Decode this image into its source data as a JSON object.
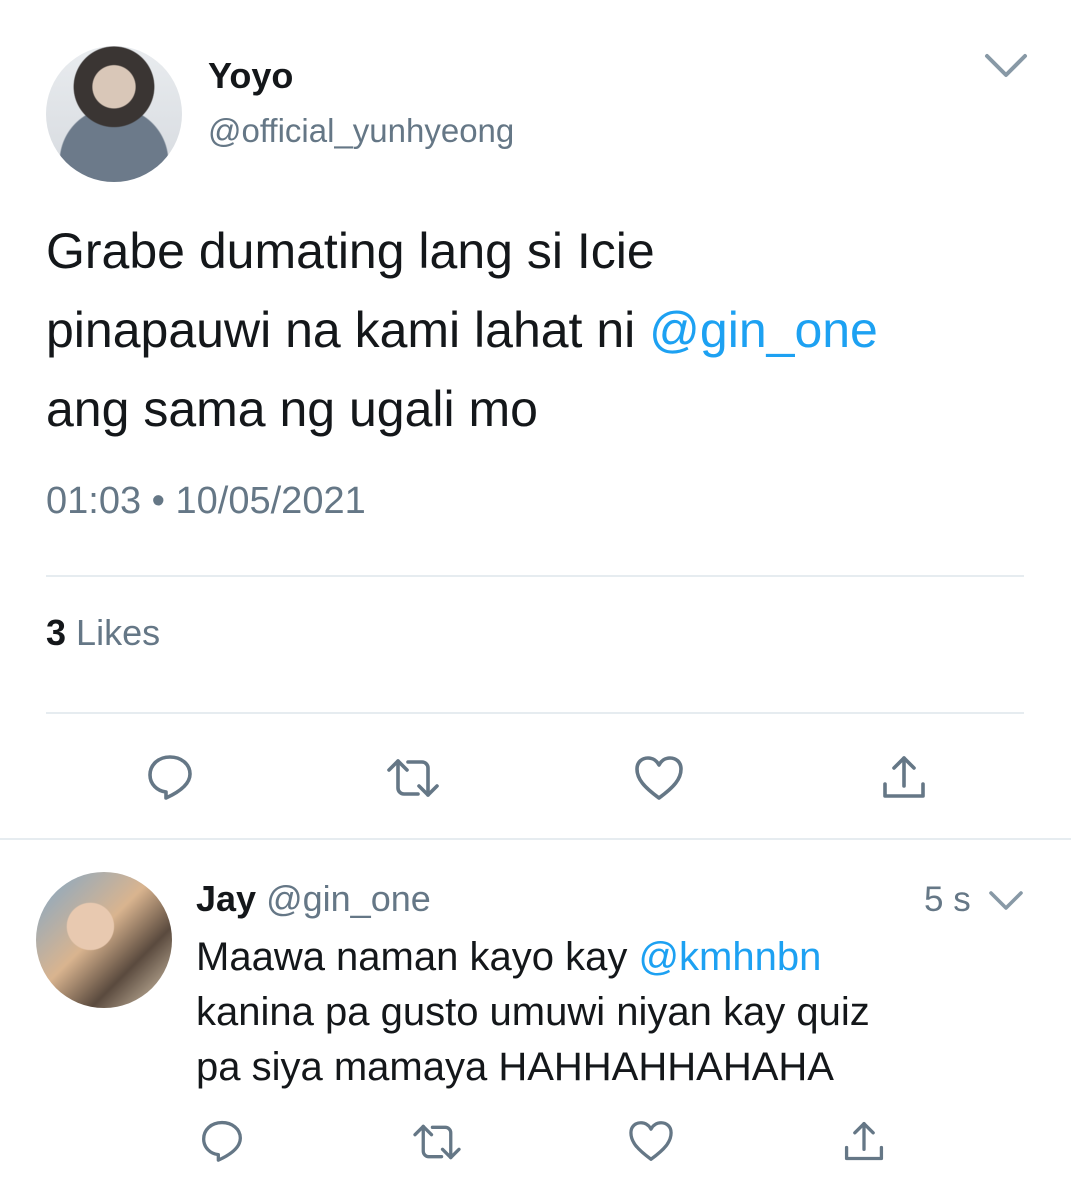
{
  "tweet": {
    "author_name": "Yoyo",
    "author_handle": "@official_yunhyeong",
    "text_line1": "Grabe dumating lang si Icie",
    "text_line2_pre": "pinapauwi na kami lahat ni ",
    "text_line2_mention": "@gin_one",
    "text_line3": "ang sama ng ugali mo",
    "time": "01:03",
    "separator": "•",
    "date": "10/05/2021",
    "likes_count": "3",
    "likes_label": "Likes"
  },
  "reply": {
    "author_name": "Jay",
    "author_handle": "@gin_one",
    "time": "5 s",
    "text_line1_pre": "Maawa naman kayo kay ",
    "text_line1_mention": "@kmhnbn",
    "text_line2": "kanina pa gusto umuwi niyan kay quiz",
    "text_line3": "pa siya mamaya HAHHAHHAHAHA"
  },
  "icons": {
    "reply": "reply-icon",
    "retweet": "retweet-icon",
    "like": "heart-icon",
    "share": "share-icon",
    "more": "chevron-down-icon"
  },
  "colors": {
    "mention": "#1da1f2",
    "secondary_text": "#657786",
    "icon": "#657786",
    "divider": "#e6ecf0"
  }
}
